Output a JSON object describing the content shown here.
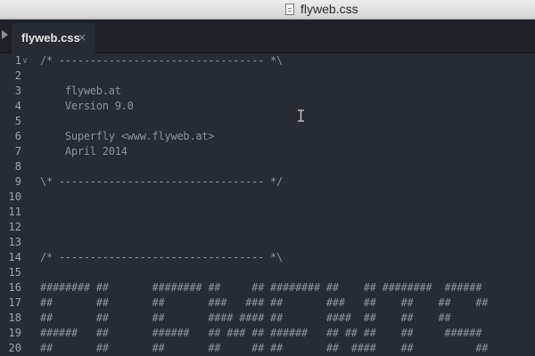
{
  "window": {
    "title": "flyweb.css"
  },
  "tab": {
    "label": "flyweb.css",
    "close_glyph": "×"
  },
  "editor": {
    "lines": [
      {
        "num": "1",
        "text": "/* --------------------------------- *\\",
        "fold": true
      },
      {
        "num": "2",
        "text": ""
      },
      {
        "num": "3",
        "text": "    flyweb.at"
      },
      {
        "num": "4",
        "text": "    Version 9.0"
      },
      {
        "num": "5",
        "text": ""
      },
      {
        "num": "6",
        "text": "    Superfly <www.flyweb.at>"
      },
      {
        "num": "7",
        "text": "    April 2014"
      },
      {
        "num": "8",
        "text": ""
      },
      {
        "num": "9",
        "text": "\\* --------------------------------- */"
      },
      {
        "num": "10",
        "text": ""
      },
      {
        "num": "11",
        "text": ""
      },
      {
        "num": "12",
        "text": ""
      },
      {
        "num": "13",
        "text": ""
      },
      {
        "num": "14",
        "text": "/* --------------------------------- *\\"
      },
      {
        "num": "15",
        "text": ""
      },
      {
        "num": "16",
        "text": "######## ##       ######## ##     ## ######## ##    ## ########  ######"
      },
      {
        "num": "17",
        "text": "##       ##       ##       ###   ### ##       ###   ##    ##    ##    ##"
      },
      {
        "num": "18",
        "text": "##       ##       ##       #### #### ##       ####  ##    ##    ##"
      },
      {
        "num": "19",
        "text": "######   ##       ######   ## ### ## ######   ## ## ##    ##     ######"
      },
      {
        "num": "20",
        "text": "##       ##       ##       ##     ## ##       ##  ####    ##          ##"
      }
    ]
  }
}
